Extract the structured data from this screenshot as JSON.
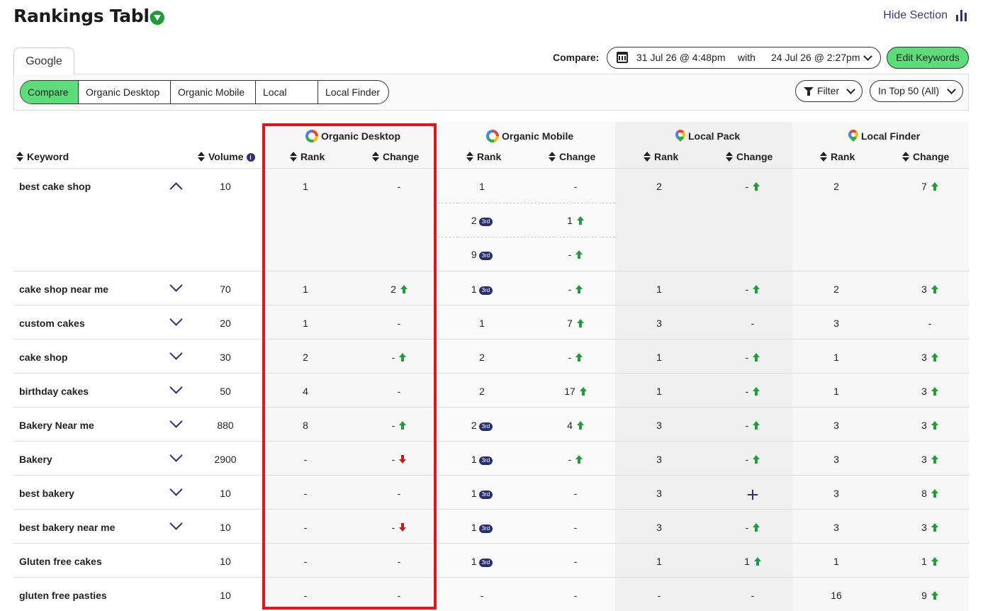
{
  "header": {
    "title": "Rankings Table",
    "hide_section": "Hide Section"
  },
  "tabs": {
    "google": "Google"
  },
  "compare": {
    "label": "Compare:",
    "date_from": "31 Jul 26 @ 4:48pm",
    "with": "with",
    "date_to": "24 Jul 26 @ 2:27pm"
  },
  "edit_keywords": "Edit Keywords",
  "segments": [
    "Compare",
    "Organic Desktop",
    "Organic Mobile",
    "Local Pack",
    "Local Finder"
  ],
  "filter": {
    "label": "Filter",
    "top": "In Top 50 (All)"
  },
  "columns": {
    "keyword": "Keyword",
    "volume": "Volume",
    "info": "i",
    "groups": [
      "Organic Desktop",
      "Organic Mobile",
      "Local Pack",
      "Local Finder"
    ],
    "rank": "Rank",
    "change": "Change"
  },
  "badge": "3rd",
  "rows": [
    {
      "keyword": "best cake shop",
      "volume": "10",
      "expanded": true,
      "od": [
        "1",
        "-",
        "none"
      ],
      "om": [
        [
          "1",
          false,
          "-",
          "none"
        ],
        [
          "2",
          true,
          "1",
          "up"
        ],
        [
          "9",
          true,
          "-",
          "up"
        ]
      ],
      "lp": [
        "2",
        "-",
        "up"
      ],
      "lf": [
        "2",
        "7",
        "up"
      ]
    },
    {
      "keyword": "cake shop near me",
      "volume": "70",
      "od": [
        "1",
        "2",
        "up"
      ],
      "om": [
        [
          "1",
          true,
          "-",
          "up"
        ]
      ],
      "lp": [
        "1",
        "-",
        "up"
      ],
      "lf": [
        "2",
        "3",
        "up"
      ]
    },
    {
      "keyword": "custom cakes",
      "volume": "20",
      "od": [
        "1",
        "-",
        "none"
      ],
      "om": [
        [
          "1",
          false,
          "7",
          "up"
        ]
      ],
      "lp": [
        "3",
        "-",
        "none"
      ],
      "lf": [
        "3",
        "-",
        "none"
      ]
    },
    {
      "keyword": "cake shop",
      "volume": "30",
      "od": [
        "2",
        "-",
        "up"
      ],
      "om": [
        [
          "2",
          false,
          "-",
          "up"
        ]
      ],
      "lp": [
        "1",
        "-",
        "up"
      ],
      "lf": [
        "1",
        "3",
        "up"
      ]
    },
    {
      "keyword": "birthday cakes",
      "volume": "50",
      "od": [
        "4",
        "-",
        "none"
      ],
      "om": [
        [
          "2",
          false,
          "17",
          "up"
        ]
      ],
      "lp": [
        "1",
        "-",
        "up"
      ],
      "lf": [
        "1",
        "3",
        "up"
      ]
    },
    {
      "keyword": "Bakery Near me",
      "volume": "880",
      "od": [
        "8",
        "-",
        "up"
      ],
      "om": [
        [
          "2",
          true,
          "4",
          "up"
        ]
      ],
      "lp": [
        "3",
        "-",
        "up"
      ],
      "lf": [
        "3",
        "3",
        "up"
      ]
    },
    {
      "keyword": "Bakery",
      "volume": "2900",
      "od": [
        "-",
        "-",
        "down"
      ],
      "om": [
        [
          "1",
          true,
          "-",
          "up"
        ]
      ],
      "lp": [
        "3",
        "-",
        "up"
      ],
      "lf": [
        "3",
        "3",
        "up"
      ]
    },
    {
      "keyword": "best bakery",
      "volume": "10",
      "od": [
        "-",
        "-",
        "none"
      ],
      "om": [
        [
          "1",
          true,
          "-",
          "none"
        ]
      ],
      "lp": [
        "3",
        "+",
        "plus"
      ],
      "lf": [
        "3",
        "8",
        "up"
      ]
    },
    {
      "keyword": "best bakery near me",
      "volume": "10",
      "od": [
        "-",
        "-",
        "down"
      ],
      "om": [
        [
          "1",
          true,
          "-",
          "none"
        ]
      ],
      "lp": [
        "3",
        "-",
        "up"
      ],
      "lf": [
        "3",
        "3",
        "up"
      ]
    },
    {
      "keyword": "Gluten free cakes",
      "volume": "10",
      "nochev": true,
      "od": [
        "-",
        "-",
        "none"
      ],
      "om": [
        [
          "1",
          true,
          "-",
          "none"
        ]
      ],
      "lp": [
        "1",
        "1",
        "up"
      ],
      "lf": [
        "1",
        "1",
        "up"
      ]
    },
    {
      "keyword": "gluten free pasties",
      "volume": "10",
      "nochev": true,
      "od": [
        "-",
        "-",
        "none"
      ],
      "om": [
        [
          "-",
          false,
          "-",
          "none"
        ]
      ],
      "lp": [
        "-",
        "-",
        "none"
      ],
      "lf": [
        "16",
        "9",
        "up"
      ]
    }
  ]
}
